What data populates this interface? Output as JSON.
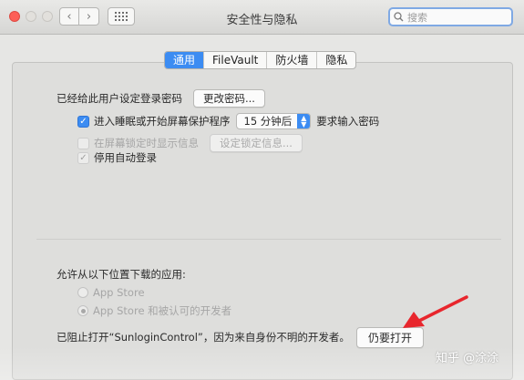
{
  "window": {
    "title": "安全性与隐私",
    "search_placeholder": "搜索"
  },
  "tabs": [
    {
      "label": "通用",
      "active": true
    },
    {
      "label": "FileVault",
      "active": false
    },
    {
      "label": "防火墙",
      "active": false
    },
    {
      "label": "隐私",
      "active": false
    }
  ],
  "general": {
    "password_label": "已经给此用户设定登录密码",
    "change_password_button": "更改密码...",
    "sleep_checkbox_label": "进入睡眠或开始屏幕保护程序",
    "sleep_checkbox_checked": true,
    "sleep_delay_value": "15 分钟后",
    "sleep_suffix": "要求输入密码",
    "lock_message_label": "在屏幕锁定时显示信息",
    "lock_message_checked": false,
    "lock_message_button": "设定锁定信息...",
    "auto_login_label": "停用自动登录",
    "auto_login_checked": true
  },
  "downloads": {
    "heading": "允许从以下位置下载的应用:",
    "options": [
      {
        "label": "App Store",
        "selected": false
      },
      {
        "label": "App Store 和被认可的开发者",
        "selected": true
      }
    ],
    "blocked_message": "已阻止打开“SunloginControl”，因为来自身份不明的开发者。",
    "open_anyway_button": "仍要打开"
  },
  "watermark": "知乎 @涂涂",
  "colors": {
    "accent": "#3c8cf2",
    "annotation_arrow": "#e8262d"
  }
}
